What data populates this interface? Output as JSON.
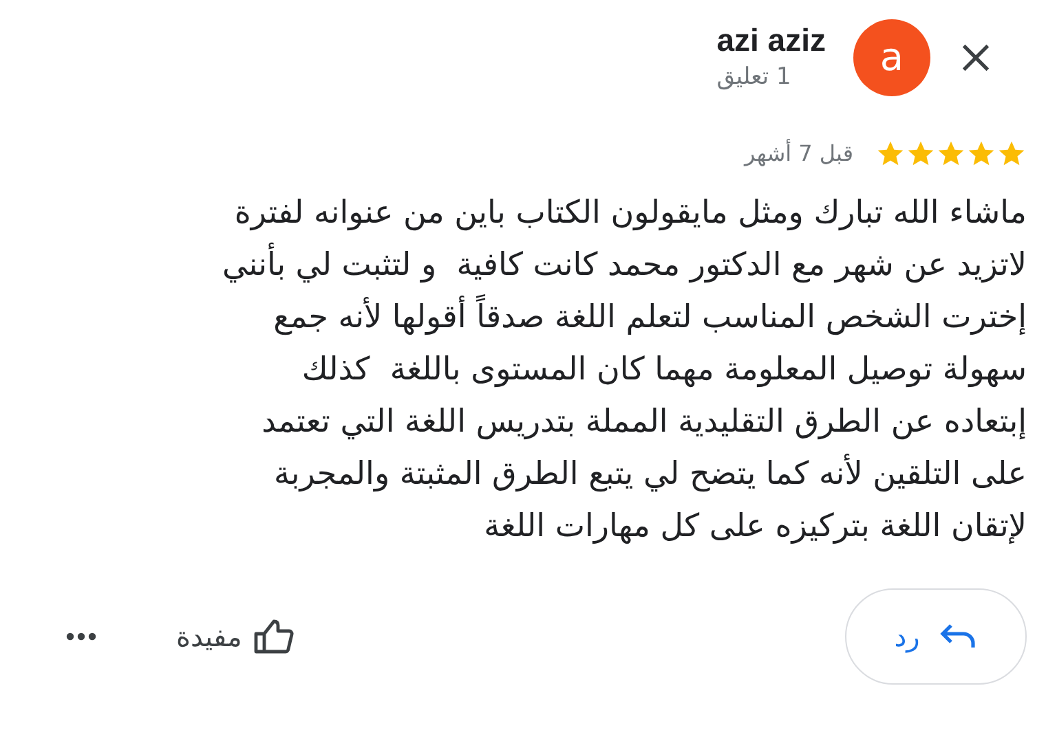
{
  "author": {
    "name": "azi aziz",
    "initial": "a",
    "color": "#f4511e",
    "reviews": "1 تعليق"
  },
  "rating": {
    "stars": 5,
    "time": "قبل 7 أشهر"
  },
  "text": "ماشاء الله تبارك ومثل مايقولون الكتاب باين من عنوانه لفترة\nلاتزيد عن شهر مع الدكتور محمد كانت كافية  و لتثبت لي بأنني\nإخترت الشخص المناسب لتعلم اللغة صدقاً أقولها لأنه جمع\nسهولة توصيل المعلومة مهما كان المستوى باللغة  كذلك\nإبتعاده عن الطرق التقليدية المملة بتدريس اللغة التي تعتمد\nعلى التلقين لأنه كما يتضح لي يتبع الطرق المثبتة والمجربة\nلإتقان اللغة بتركيزه على كل مهارات اللغة",
  "actions": {
    "reply": "رد",
    "helpful": "مفيدة"
  }
}
